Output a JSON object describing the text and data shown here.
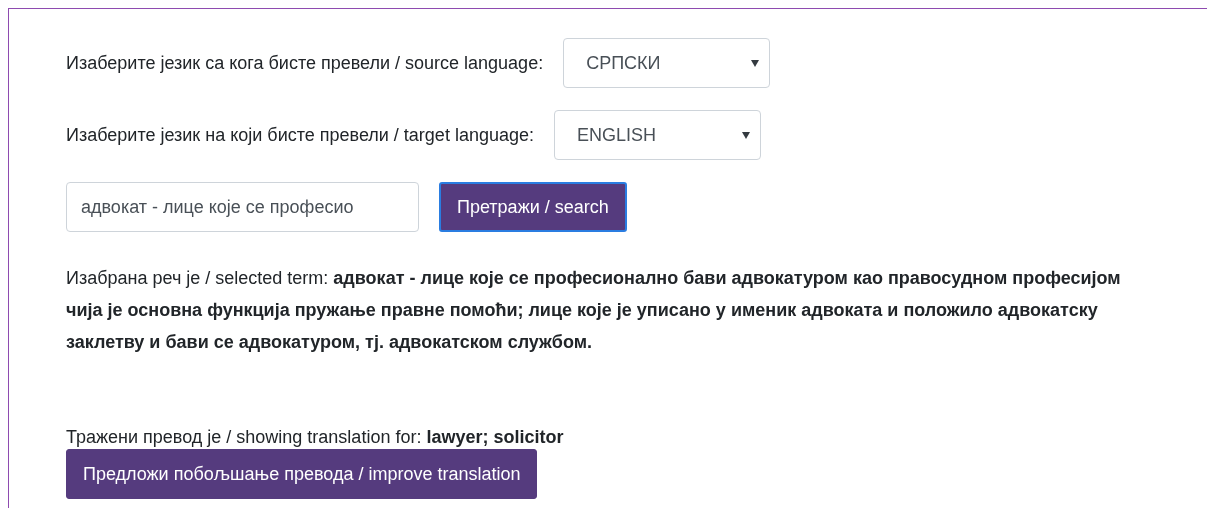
{
  "source_language": {
    "label": "Изаберите језик са кога бисте превели / source language:",
    "value": "СРПСКИ"
  },
  "target_language": {
    "label": "Изаберите језик на који бисте превели / target language:",
    "value": "ENGLISH"
  },
  "search": {
    "value": "адвокат - лице које се професио",
    "button": "Претражи / search"
  },
  "selected_term": "Изабрана реч је / selected term: **адвокат - лице које се професионално бави адвокатуром као правосудном професијом чија је основна функција пружање правне помоћи; лице које је уписано у именик адвоката и положило адвокатску заклетву и бави се адвокатуром, тј. адвокатском службом.**",
  "translation": "Тражени превод је / showing translation for: **lawyer; solicitor**",
  "improve_button": "Предложи побољшање превода / improve translation"
}
